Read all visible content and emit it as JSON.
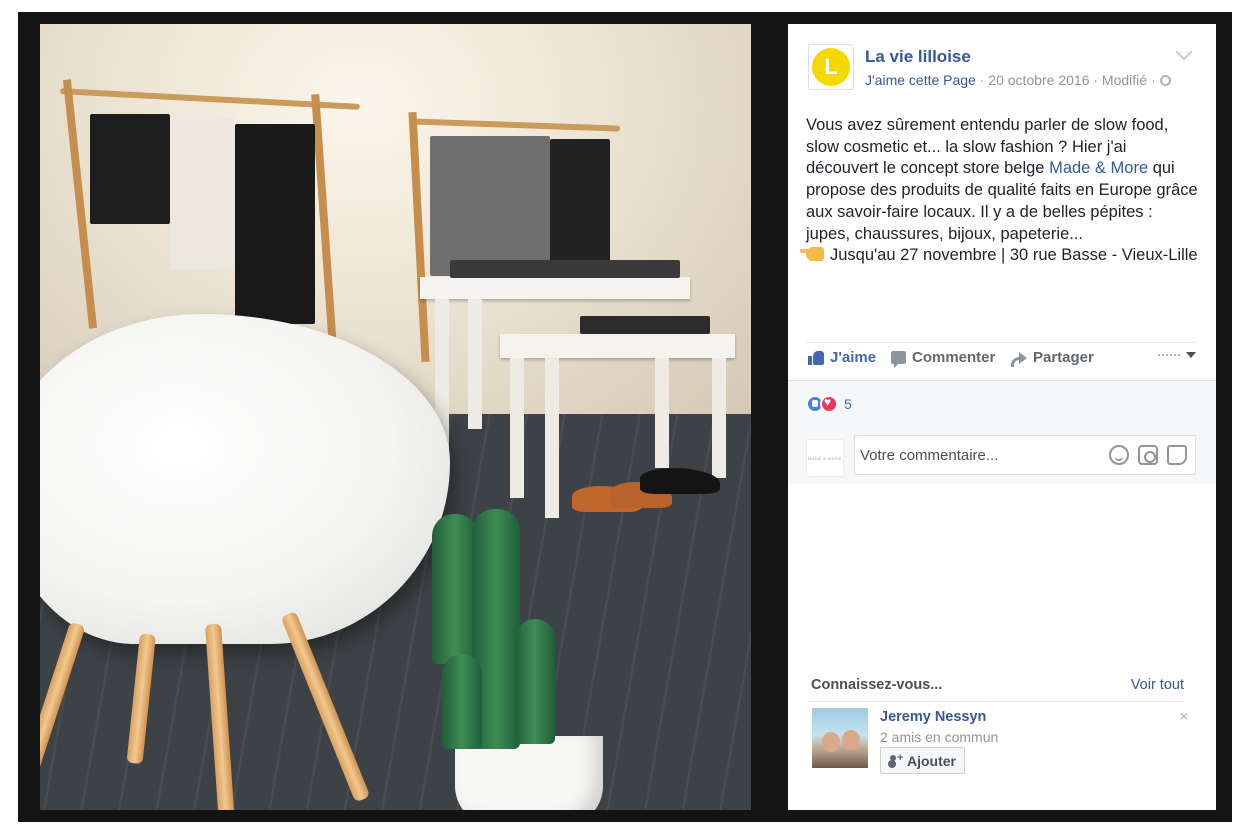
{
  "photo": {
    "alt_icon": "store-interior-photo"
  },
  "post": {
    "page_name": "La vie lilloise",
    "avatar_letter": "L",
    "like_page": "J'aime cette Page",
    "meta_rest": " · 20 octobre 2016 · Modifié ·",
    "text_part1": "Vous avez sûrement entendu parler de slow food, slow cosmetic et... la slow fashion ? Hier j'ai découvert le concept store belge ",
    "text_link": "Made & More",
    "text_part2": " qui propose des produits de qualité faits en Europe grâce aux savoir-faire locaux. Il y a de belles pépites : jupes, chaussures, bijoux, papeterie...",
    "text_part3": "Jusqu'au 27 novembre | 30 rue Basse - Vieux-Lille"
  },
  "actions": {
    "like": "J'aime",
    "comment": "Commenter",
    "share": "Partager"
  },
  "reactions": {
    "count": "5"
  },
  "comment": {
    "avatar_text": "MADE & MORE",
    "placeholder": "Votre commentaire..."
  },
  "pymk": {
    "title": "Connaissez-vous...",
    "see_all": "Voir tout",
    "name": "Jeremy Nessyn",
    "mutual": "2 amis en commun",
    "add_label": "Ajouter",
    "dismiss": "×"
  },
  "colors": {
    "link_blue": "#365899",
    "avatar_yellow": "#f5d800",
    "frame_dark": "#141414"
  }
}
